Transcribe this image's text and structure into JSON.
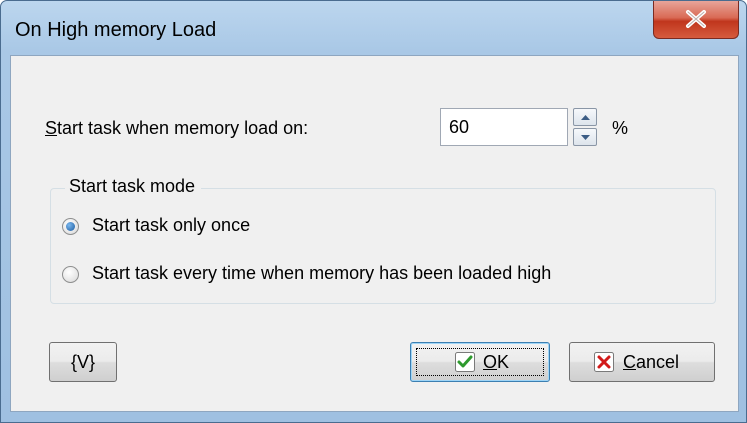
{
  "window": {
    "title": "On High memory Load"
  },
  "threshold": {
    "label_accel": "S",
    "label_rest": "tart task when memory load on:",
    "value": "60",
    "unit": "%"
  },
  "mode_group": {
    "legend": "Start task mode",
    "options": [
      {
        "label": "Start task only once",
        "checked": true
      },
      {
        "label": "Start task every time when memory has been loaded high",
        "checked": false
      }
    ]
  },
  "buttons": {
    "variables_label": "{V}",
    "ok_accel": "O",
    "ok_rest": "K",
    "cancel_accel": "C",
    "cancel_rest": "ancel"
  },
  "icons": {
    "close": "close-icon",
    "spin_up": "chevron-up-icon",
    "spin_down": "chevron-down-icon",
    "ok": "checkmark-icon",
    "cancel": "x-icon"
  },
  "colors": {
    "title_bar": "#a9c8e6",
    "close_button": "#c0361d",
    "client_bg": "#f0f0f0",
    "ok_check": "#2e9a2e",
    "cancel_x": "#d21a1a",
    "radio_selected": "#1c5a9e"
  }
}
